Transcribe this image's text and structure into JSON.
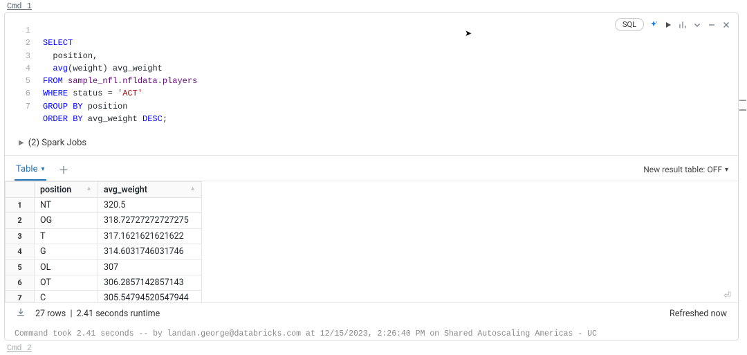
{
  "cell_label": "Cmd 1",
  "next_cell_label": "Cmd 2",
  "language": "SQL",
  "code_lines": [
    "1",
    "2",
    "3",
    "4",
    "5",
    "6",
    "7"
  ],
  "sql": {
    "select": "SELECT",
    "position": "position",
    "comma": ",",
    "avg": "avg",
    "open": "(",
    "weight": "weight",
    "close": ")",
    "alias": " avg_weight",
    "from": "FROM",
    "tbl1": " sample_nfl",
    "dot": ".",
    "tbl2": "nfldata",
    "tbl3": "players",
    "where": "WHERE",
    "status": " status ",
    "eq": "=",
    "lit": " 'ACT'",
    "groupby": "GROUP BY",
    "gcol": " position",
    "orderby": "ORDER BY",
    "ocol": " avg_weight ",
    "desc": "DESC",
    "semi": ";"
  },
  "spark_jobs": "(2) Spark Jobs",
  "tab_table": "Table",
  "result_toggle": "New result table: OFF",
  "columns": {
    "position": "position",
    "avg_weight": "avg_weight"
  },
  "rows": [
    {
      "n": "1",
      "position": "NT",
      "avg_weight": "320.5"
    },
    {
      "n": "2",
      "position": "OG",
      "avg_weight": "318.72727272727275"
    },
    {
      "n": "3",
      "position": "T",
      "avg_weight": "317.1621621621622"
    },
    {
      "n": "4",
      "position": "G",
      "avg_weight": "314.6031746031746"
    },
    {
      "n": "5",
      "position": "OL",
      "avg_weight": "307"
    },
    {
      "n": "6",
      "position": "OT",
      "avg_weight": "306.2857142857143"
    },
    {
      "n": "7",
      "position": "C",
      "avg_weight": "305.54794520547944"
    }
  ],
  "status": {
    "rows": "27 rows",
    "sep": "|",
    "runtime": "2.41 seconds runtime",
    "refreshed": "Refreshed now"
  },
  "footer": "Command took 2.41 seconds -- by landan.george@databricks.com at 12/15/2023, 2:26:40 PM on Shared Autoscaling Americas - UC"
}
